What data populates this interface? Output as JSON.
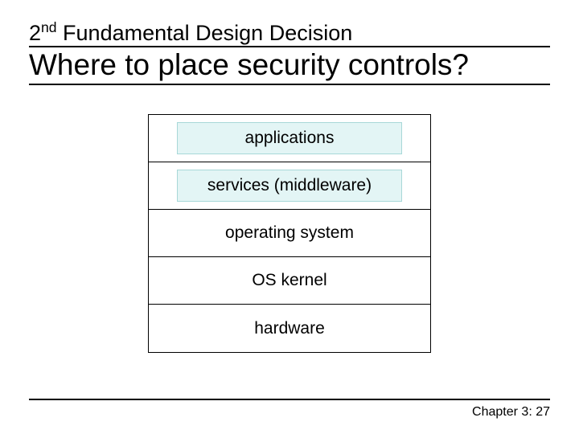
{
  "subtitle_prefix": "2",
  "subtitle_super": "nd",
  "subtitle_rest": " Fundamental Design Decision",
  "title": "Where to place security controls?",
  "layers": {
    "l0": "applications",
    "l1": "services (middleware)",
    "l2": "operating system",
    "l3": "OS kernel",
    "l4": "hardware"
  },
  "footer": "Chapter 3: 27"
}
